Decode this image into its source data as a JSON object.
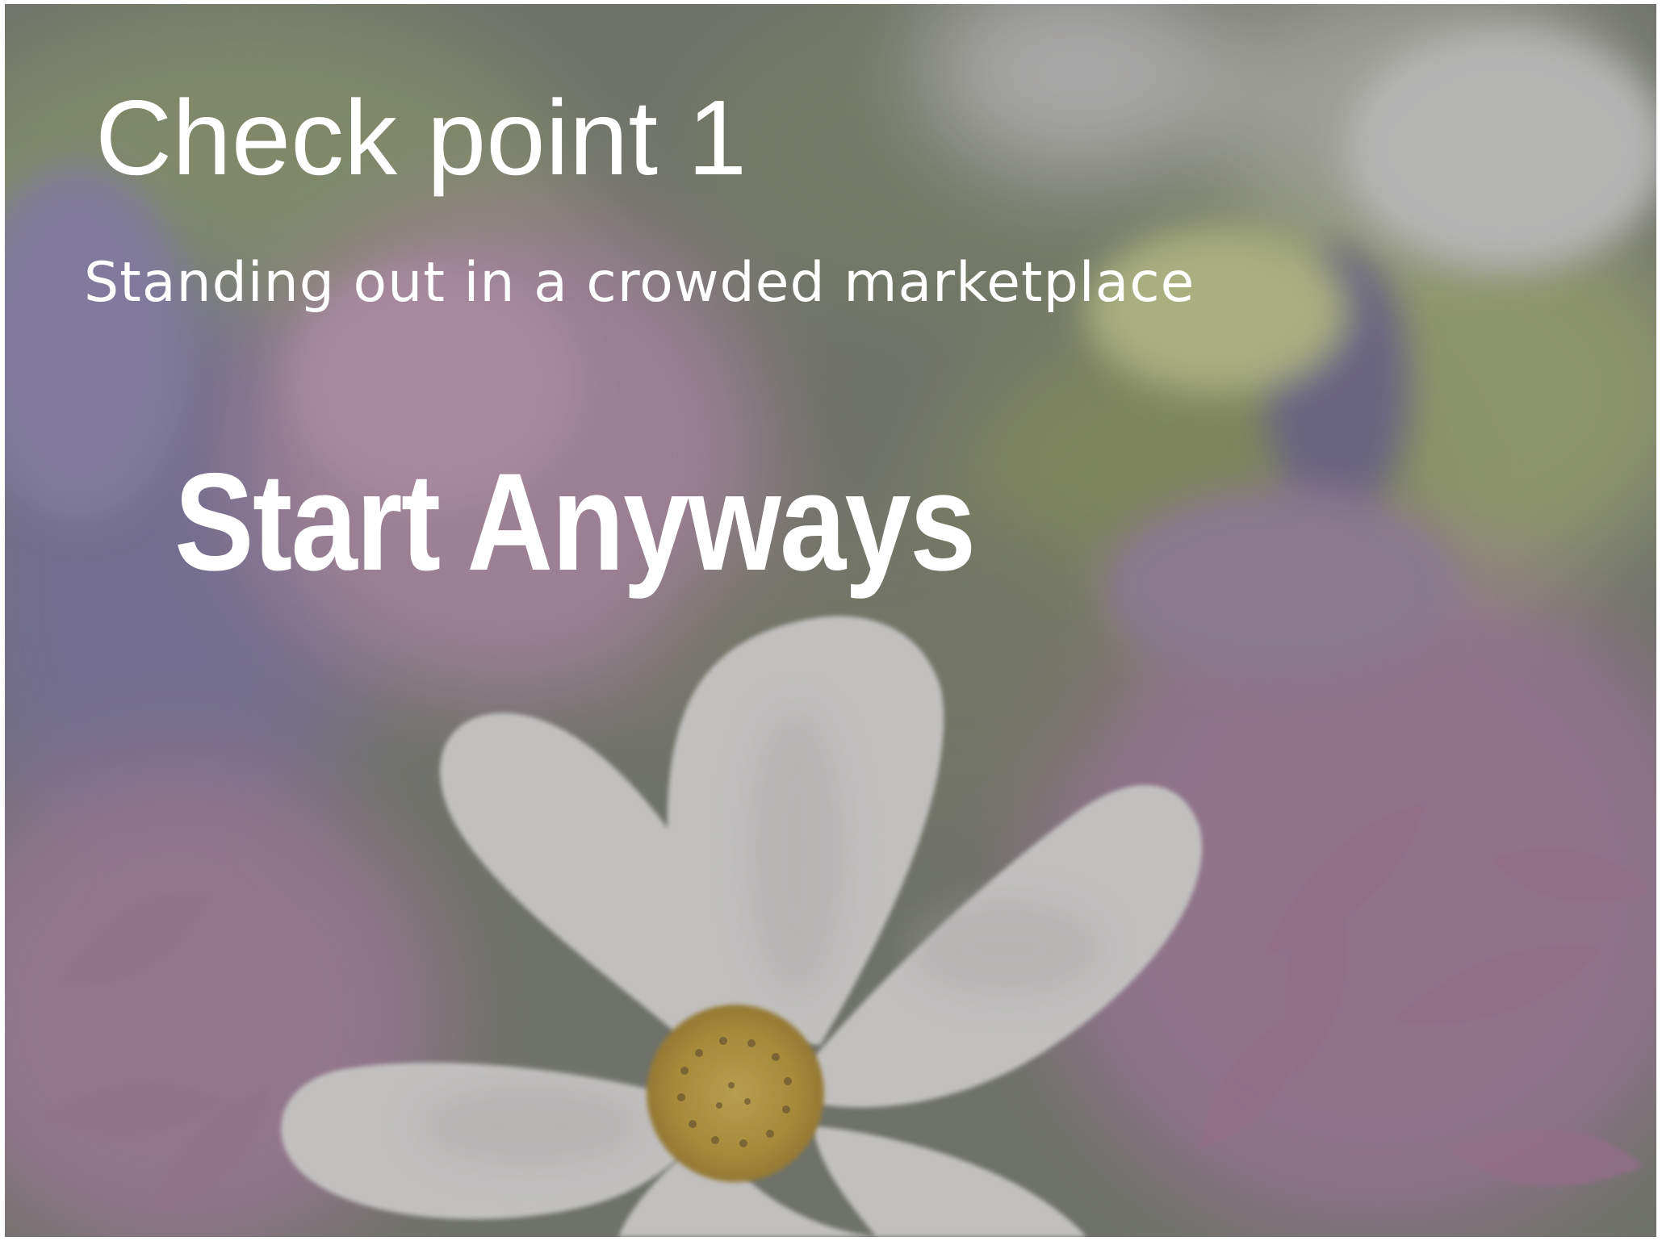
{
  "slide": {
    "title": "Check point 1",
    "subtitle": "Standing out in a crowded marketplace",
    "headline": "Start Anyways"
  },
  "colors": {
    "text": "#ffffff",
    "overlay": "#5f5f5f",
    "petal_white": "#e9e7e6",
    "flower_center": "#c9a63a",
    "pink_flower": "#a5789a",
    "purple_flower": "#7f6f9e",
    "foliage_green": "#8c9564"
  }
}
